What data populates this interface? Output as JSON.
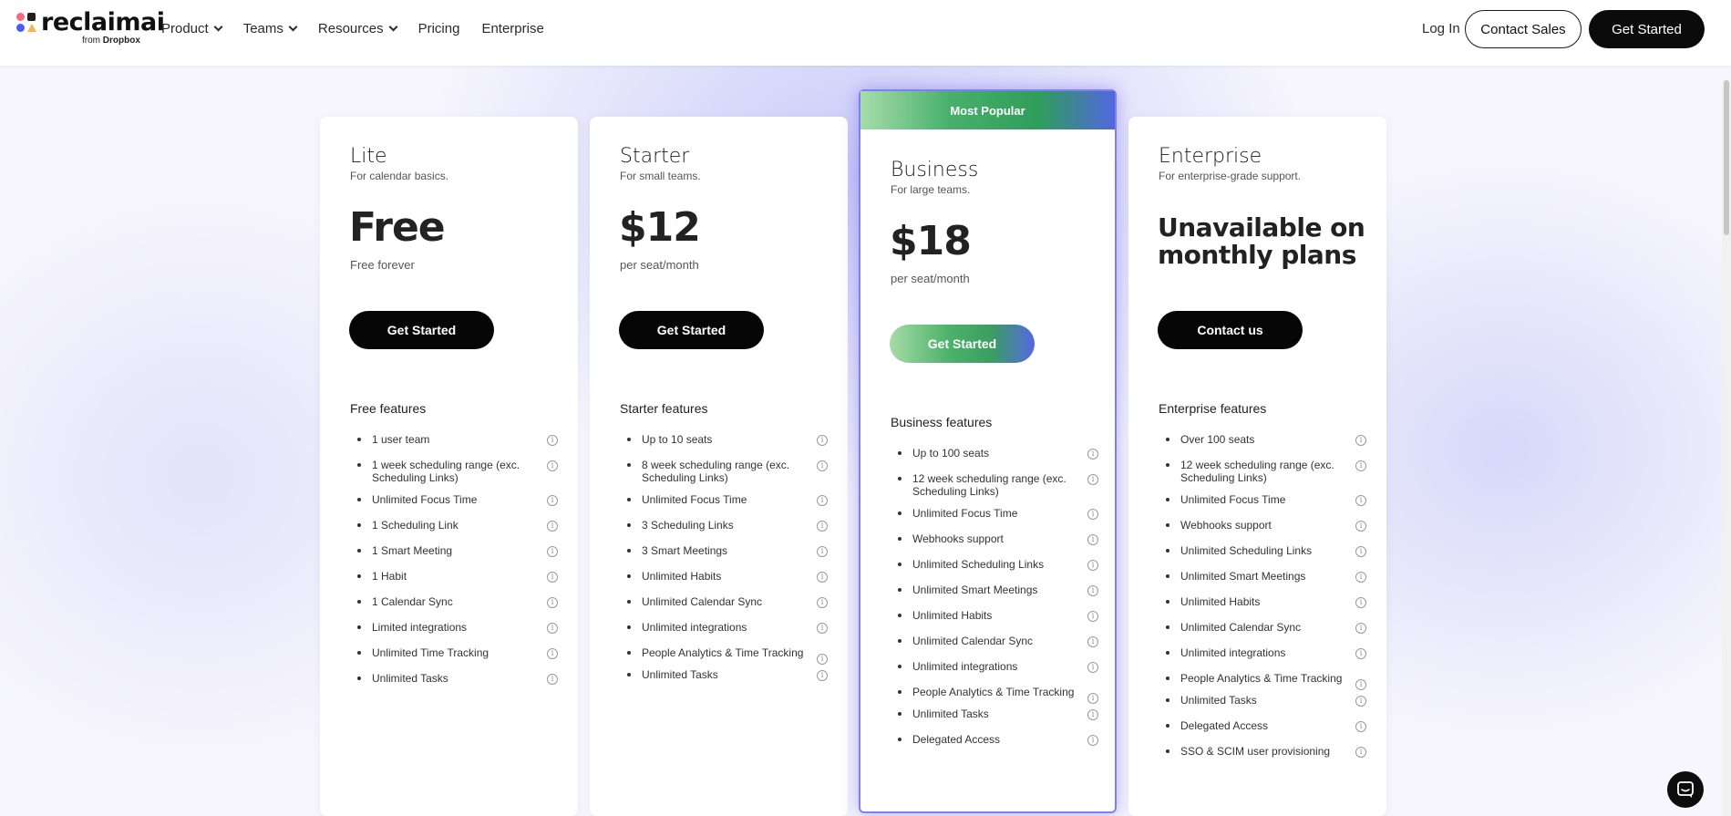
{
  "header": {
    "logo_text": "reclaimai",
    "logo_sub_prefix": "from",
    "logo_sub_brand": "Dropbox",
    "nav": [
      {
        "label": "Product",
        "dropdown": true
      },
      {
        "label": "Teams",
        "dropdown": true
      },
      {
        "label": "Resources",
        "dropdown": true
      },
      {
        "label": "Pricing",
        "dropdown": false
      },
      {
        "label": "Enterprise",
        "dropdown": false
      }
    ],
    "login": "Log In",
    "contact_sales": "Contact Sales",
    "get_started": "Get Started"
  },
  "plans": [
    {
      "name": "Lite",
      "subtitle": "For calendar basics.",
      "price": "Free",
      "period": "Free forever",
      "button": "Get Started",
      "features_title": "Free features",
      "features": [
        "1 user team",
        "1 week scheduling range (exc. Scheduling Links)",
        "Unlimited Focus Time",
        "1 Scheduling Link",
        "1 Smart Meeting",
        "1 Habit",
        "1 Calendar Sync",
        "Limited integrations",
        "Unlimited Time Tracking",
        "Unlimited Tasks"
      ]
    },
    {
      "name": "Starter",
      "subtitle": "For small teams.",
      "price": "$12",
      "period": "per seat/month",
      "button": "Get Started",
      "features_title": "Starter features",
      "features": [
        "Up to 10 seats",
        "8 week scheduling range (exc. Scheduling Links)",
        "Unlimited Focus Time",
        "3 Scheduling Links",
        "3 Smart Meetings",
        "Unlimited Habits",
        "Unlimited Calendar Sync",
        "Unlimited integrations",
        "People Analytics & Time Tracking",
        "Unlimited Tasks"
      ]
    },
    {
      "name": "Business",
      "badge": "Most Popular",
      "subtitle": "For large teams.",
      "price": "$18",
      "period": "per seat/month",
      "button": "Get Started",
      "features_title": "Business features",
      "features": [
        "Up to 100 seats",
        "12 week scheduling range (exc. Scheduling Links)",
        "Unlimited Focus Time",
        "Webhooks support",
        "Unlimited Scheduling Links",
        "Unlimited Smart Meetings",
        "Unlimited Habits",
        "Unlimited Calendar Sync",
        "Unlimited integrations",
        "People Analytics & Time Tracking",
        "Unlimited Tasks",
        "Delegated Access"
      ]
    },
    {
      "name": "Enterprise",
      "subtitle": "For enterprise-grade support.",
      "price": "Unavailable on monthly plans",
      "period": "",
      "button": "Contact us",
      "features_title": "Enterprise features",
      "features": [
        "Over 100 seats",
        "12 week scheduling range (exc. Scheduling Links)",
        "Unlimited Focus Time",
        "Webhooks support",
        "Unlimited Scheduling Links",
        "Unlimited Smart Meetings",
        "Unlimited Habits",
        "Unlimited Calendar Sync",
        "Unlimited integrations",
        "People Analytics & Time Tracking",
        "Unlimited Tasks",
        "Delegated Access",
        "SSO & SCIM user provisioning"
      ]
    }
  ],
  "info_glyph": "i",
  "colors": {
    "cta_black": "#060606",
    "popular_gradient_start": "#a7dcaa",
    "popular_gradient_mid": "#2f9d5a",
    "popular_gradient_end": "#5167e0",
    "popular_glow": "#7f7ff0"
  },
  "icons": [
    "logo-icon",
    "chevron-down-icon",
    "info-icon",
    "chat-icon"
  ]
}
